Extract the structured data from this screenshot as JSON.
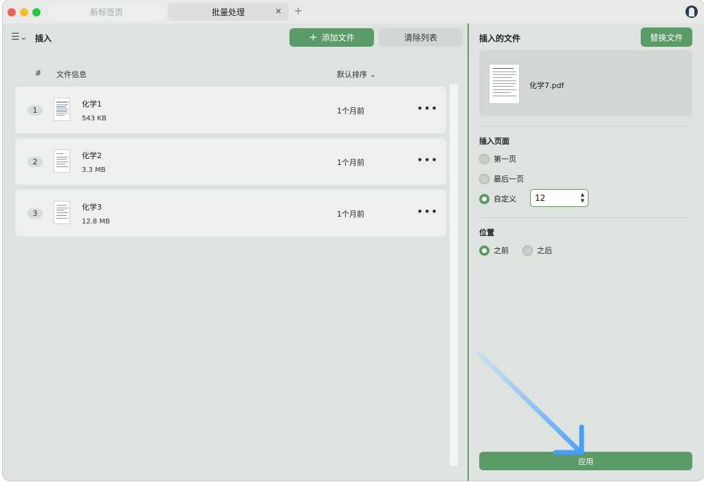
{
  "tabs": [
    {
      "label": "新标签页",
      "active": false
    },
    {
      "label": "批量处理",
      "active": true
    }
  ],
  "tab_close_glyph": "×",
  "tab_add_glyph": "+",
  "left": {
    "menu_glyph": "☰⌄",
    "title": "插入",
    "add_button": {
      "icon": "plus-icon",
      "label": "添加文件"
    },
    "clear_button": {
      "label": "清除列表"
    },
    "columns": {
      "hash": "#",
      "info": "文件信息",
      "sort": "默认排序 ⌄"
    },
    "files": [
      {
        "index": "1",
        "name": "化学1",
        "size": "543 KB",
        "time": "1个月前",
        "more": "•••"
      },
      {
        "index": "2",
        "name": "化学2",
        "size": "3.3 MB",
        "time": "1个月前",
        "more": "•••"
      },
      {
        "index": "3",
        "name": "化学3",
        "size": "12.8 MB",
        "time": "1个月前",
        "more": "•••"
      }
    ]
  },
  "right": {
    "title": "插入的文件",
    "replace_button": "替换文件",
    "file_name": "化学7.pdf",
    "insert_page": {
      "title": "插入页面",
      "options": [
        "第一页",
        "最后一页",
        "自定义"
      ],
      "selected": "自定义",
      "custom_value": "12"
    },
    "position": {
      "title": "位置",
      "options": [
        "之前",
        "之后"
      ],
      "selected": "之前"
    },
    "apply_button": "应用"
  },
  "colors": {
    "accent": "#5c9a67",
    "background": "#dfe3df",
    "row": "#eef0ee",
    "arrow": "#4a9ef5"
  }
}
